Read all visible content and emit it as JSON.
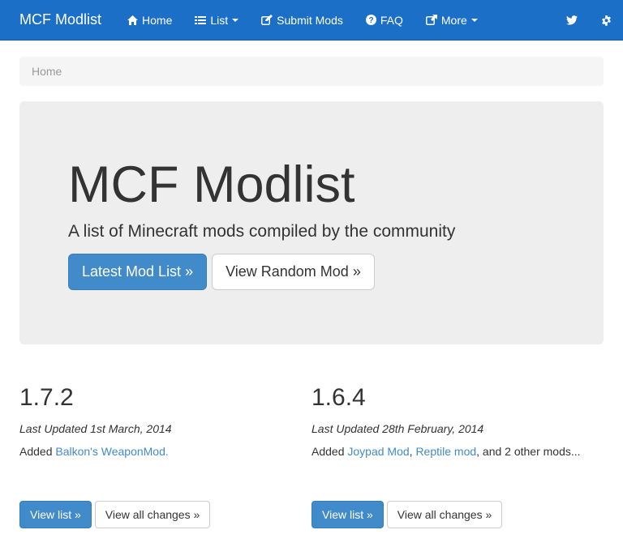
{
  "navbar": {
    "brand": "MCF Modlist",
    "items": [
      {
        "label": "Home",
        "icon": "home-icon"
      },
      {
        "label": "List",
        "icon": "list-icon",
        "dropdown": true
      },
      {
        "label": "Submit Mods",
        "icon": "edit-icon"
      },
      {
        "label": "FAQ",
        "icon": "question-circle-icon"
      },
      {
        "label": "More",
        "icon": "external-link-icon",
        "dropdown": true
      }
    ],
    "right_icons": [
      "twitter-icon",
      "gear-icon"
    ],
    "color": "#1b6fc6"
  },
  "breadcrumb": {
    "items": [
      "Home"
    ]
  },
  "jumbotron": {
    "title": "MCF Modlist",
    "lead": "A list of Minecraft mods compiled by the community",
    "primary_button": "Latest Mod List »",
    "secondary_button": "View Random Mod »"
  },
  "versions": [
    {
      "version": "1.7.2",
      "updated": "Last Updated 1st March, 2014",
      "added_prefix": "Added ",
      "links": [
        "Balkon's WeaponMod."
      ],
      "suffix": "",
      "view_list": "View list »",
      "view_changes": "View all changes »"
    },
    {
      "version": "1.6.4",
      "updated": "Last Updated 28th February, 2014",
      "added_prefix": "Added ",
      "links": [
        "Joypad Mod",
        "Reptile mod"
      ],
      "separator": ", ",
      "suffix": ", and 2 other mods...",
      "view_list": "View list »",
      "view_changes": "View all changes »"
    }
  ],
  "colors": {
    "primary": "#428bca",
    "link": "#428bca"
  }
}
